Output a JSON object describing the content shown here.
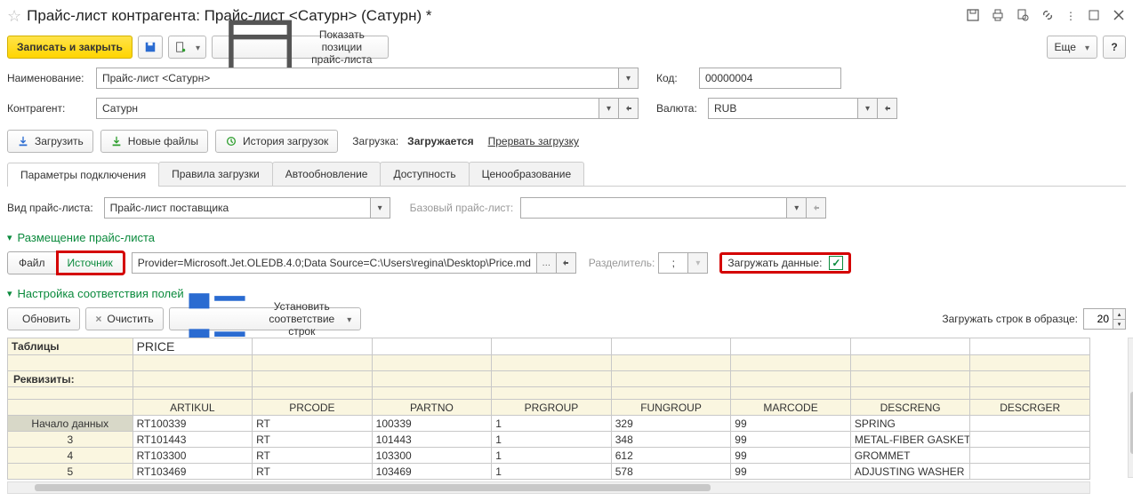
{
  "title": "Прайс-лист контрагента: Прайс-лист <Сатурн> (Сатурн) *",
  "toolbar": {
    "save_close": "Записать и закрыть",
    "show_positions": "Показать позиции прайс-листа",
    "more": "Еще",
    "help": "?"
  },
  "form": {
    "name_label": "Наименование:",
    "name_value": "Прайс-лист <Сатурн>",
    "code_label": "Код:",
    "code_value": "00000004",
    "counterparty_label": "Контрагент:",
    "counterparty_value": "Сатурн",
    "currency_label": "Валюта:",
    "currency_value": "RUB"
  },
  "actions": {
    "load": "Загрузить",
    "new_files": "Новые файлы",
    "history": "История загрузок",
    "loading_label": "Загрузка:",
    "loading_status": "Загружается",
    "cancel": "Прервать загрузку"
  },
  "tabs": {
    "conn": "Параметры подключения",
    "rules": "Правила загрузки",
    "auto": "Автообновление",
    "avail": "Доступность",
    "pricing": "Ценообразование"
  },
  "pricelist_type": {
    "label": "Вид прайс-листа:",
    "value": "Прайс-лист поставщика",
    "base_label": "Базовый прайс-лист:",
    "base_value": ""
  },
  "group_placement_title": "Размещение прайс-листа",
  "placement": {
    "file": "Файл",
    "source": "Источник",
    "conn_string": "Provider=Microsoft.Jet.OLEDB.4.0;Data Source=C:\\Users\\regina\\Desktop\\Price.mdb",
    "separator_label": "Разделитель:",
    "separator_value": ";",
    "load_data_label": "Загружать данные:",
    "load_data_checked": "✓"
  },
  "group_mapping_title": "Настройка соответствия полей",
  "mapping_toolbar": {
    "refresh": "Обновить",
    "clear": "Очистить",
    "set_rows": "Установить соответствие строк",
    "sample_rows_label": "Загружать строк в образце:",
    "sample_rows_value": "20"
  },
  "grid": {
    "tables_label": "Таблицы",
    "table_selected": "PRICE",
    "rekv_label": "Реквизиты:",
    "columns": [
      "ARTIKUL",
      "PRCODE",
      "PARTNO",
      "PRGROUP",
      "FUNGROUP",
      "MARCODE",
      "DESCRENG",
      "DESCRGER"
    ],
    "rows": [
      {
        "num": "Начало данных",
        "sel": true,
        "cells": [
          "RT100339",
          "RT",
          "100339",
          "1",
          "329",
          "99",
          "SPRING",
          ""
        ]
      },
      {
        "num": "3",
        "cells": [
          "RT101443",
          "RT",
          "101443",
          "1",
          "348",
          "99",
          "METAL-FIBER GASKET",
          ""
        ]
      },
      {
        "num": "4",
        "cells": [
          "RT103300",
          "RT",
          "103300",
          "1",
          "612",
          "99",
          "GROMMET",
          ""
        ]
      },
      {
        "num": "5",
        "cells": [
          "RT103469",
          "RT",
          "103469",
          "1",
          "578",
          "99",
          "ADJUSTING WASHER",
          ""
        ]
      }
    ]
  }
}
